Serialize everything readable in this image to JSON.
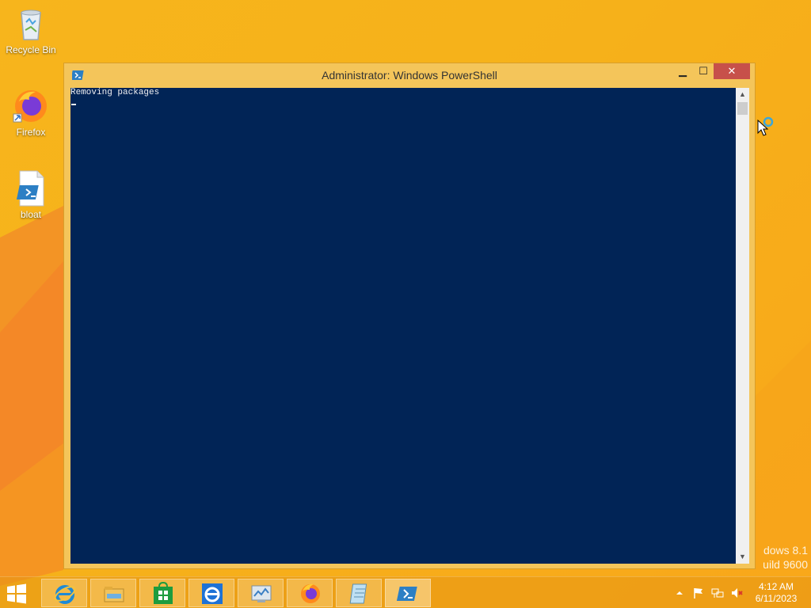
{
  "desktop": {
    "icons": [
      {
        "label": "Recycle Bin",
        "icon": "recycle-bin-icon"
      },
      {
        "label": "Firefox",
        "icon": "firefox-icon"
      },
      {
        "label": "bloat",
        "icon": "powershell-script-icon"
      }
    ],
    "watermark_line1": "dows 8.1",
    "watermark_line2": "uild 9600"
  },
  "window": {
    "title": "Administrator: Windows PowerShell",
    "minimize_glyph": "▁",
    "maximize_glyph": "☐",
    "close_glyph": "✕",
    "console_lines": [
      "Removing packages"
    ],
    "scroll_up_glyph": "▲",
    "scroll_down_glyph": "▼"
  },
  "taskbar": {
    "pinned": [
      {
        "name": "Internet Explorer",
        "icon": "internet-explorer-icon"
      },
      {
        "name": "File Explorer",
        "icon": "file-explorer-icon"
      },
      {
        "name": "Store",
        "icon": "store-icon"
      },
      {
        "name": "Internet Explorer",
        "icon": "internet-explorer-icon"
      },
      {
        "name": "Control Panel",
        "icon": "control-panel-icon"
      },
      {
        "name": "Firefox",
        "icon": "firefox-icon"
      },
      {
        "name": "Notepad",
        "icon": "notepad-icon"
      },
      {
        "name": "Windows PowerShell",
        "icon": "powershell-icon"
      }
    ],
    "tray": {
      "time": "4:12 AM",
      "date": "6/11/2023"
    }
  },
  "colors": {
    "console_bg": "#012456",
    "desktop_bg": "#f7b51c",
    "close_button": "#c7504a"
  }
}
